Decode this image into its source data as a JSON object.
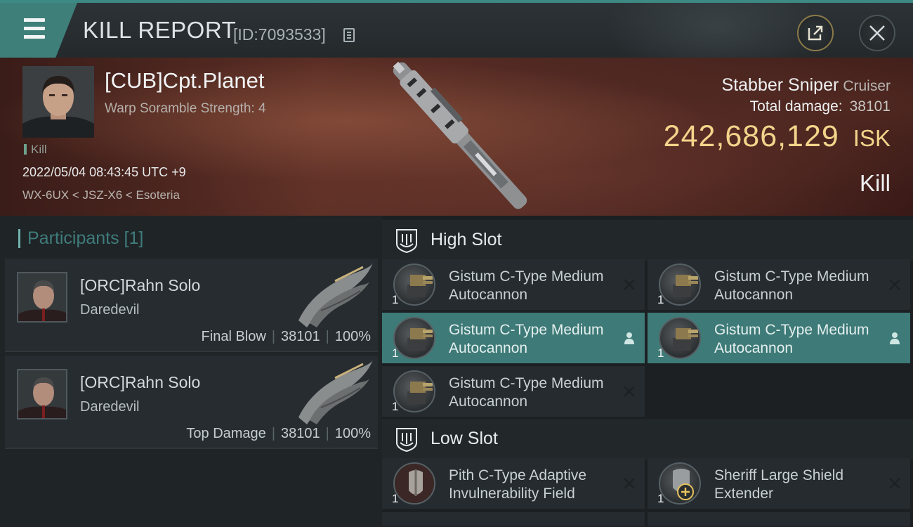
{
  "header": {
    "title": "KILL REPORT",
    "report_id": "[ID:7093533]"
  },
  "victim": {
    "name": "[CUB]Cpt.Planet",
    "subtitle": "Warp Soramble Strength: 4",
    "tag": "Kill",
    "datetime": "2022/05/04 08:43:45 UTC +9",
    "location": "WX-6UX < JSZ-X6 < Esoteria",
    "ship": "Stabber Sniper",
    "ship_class": "Cruiser",
    "damage_label": "Total damage:",
    "total_damage": "38101",
    "isk_value": "242,686,129",
    "isk_unit": "ISK",
    "result": "Kill"
  },
  "participants": {
    "title": "Participants [1]",
    "items": [
      {
        "name": "[ORC]Rahn Solo",
        "ship": "Daredevil",
        "role": "Final Blow",
        "damage": "38101",
        "percent": "100%"
      },
      {
        "name": "[ORC]Rahn Solo",
        "ship": "Daredevil",
        "role": "Top Damage",
        "damage": "38101",
        "percent": "100%"
      }
    ]
  },
  "slots": {
    "high": {
      "label": "High Slot",
      "items": [
        {
          "name": "Gistum C-Type Medium Autocannon",
          "qty": "1",
          "status": "destroyed"
        },
        {
          "name": "Gistum C-Type Medium Autocannon",
          "qty": "1",
          "status": "destroyed"
        },
        {
          "name": "Gistum C-Type Medium Autocannon",
          "qty": "1",
          "status": "dropped"
        },
        {
          "name": "Gistum C-Type Medium Autocannon",
          "qty": "1",
          "status": "dropped"
        },
        {
          "name": "Gistum C-Type Medium Autocannon",
          "qty": "1",
          "status": "destroyed"
        }
      ]
    },
    "low": {
      "label": "Low Slot",
      "items": [
        {
          "name": "Pith C-Type Adaptive Invulnerability Field",
          "qty": "1",
          "status": "destroyed"
        },
        {
          "name": "Sheriff Large Shield Extender",
          "qty": "1",
          "status": "destroyed"
        }
      ]
    }
  },
  "colors": {
    "accent": "#3f7f7a",
    "isk": "#f3d48b",
    "active_row": "#3e7a77"
  },
  "icons": [
    "menu-icon",
    "copy-icon",
    "share-icon",
    "close-icon",
    "shield-slot-icon",
    "person-icon",
    "x-icon"
  ]
}
